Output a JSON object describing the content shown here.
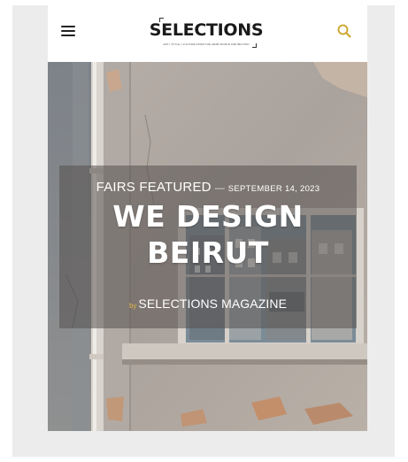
{
  "colors": {
    "accent": "#c9a227",
    "overlay": "#55504e",
    "header_bg": "#ffffff",
    "frame_bg": "#ececec"
  },
  "header": {
    "menu_icon": "hamburger-menu-icon",
    "logo": {
      "wordmark": "SELECTIONS",
      "tagline": "ART | STYLE | CULTURE FROM THE ARAB WORLD AND BEYOND"
    },
    "search_icon": "search-icon"
  },
  "article": {
    "category": "FAIRS FEATURED",
    "separator": "—",
    "date": "SEPTEMBER 14, 2023",
    "title_line1": "WE DESIGN",
    "title_line2": "BEIRUT",
    "by_label": "by",
    "author": "SELECTIONS MAGAZINE",
    "image": "weathered-wall-with-window-photo"
  }
}
